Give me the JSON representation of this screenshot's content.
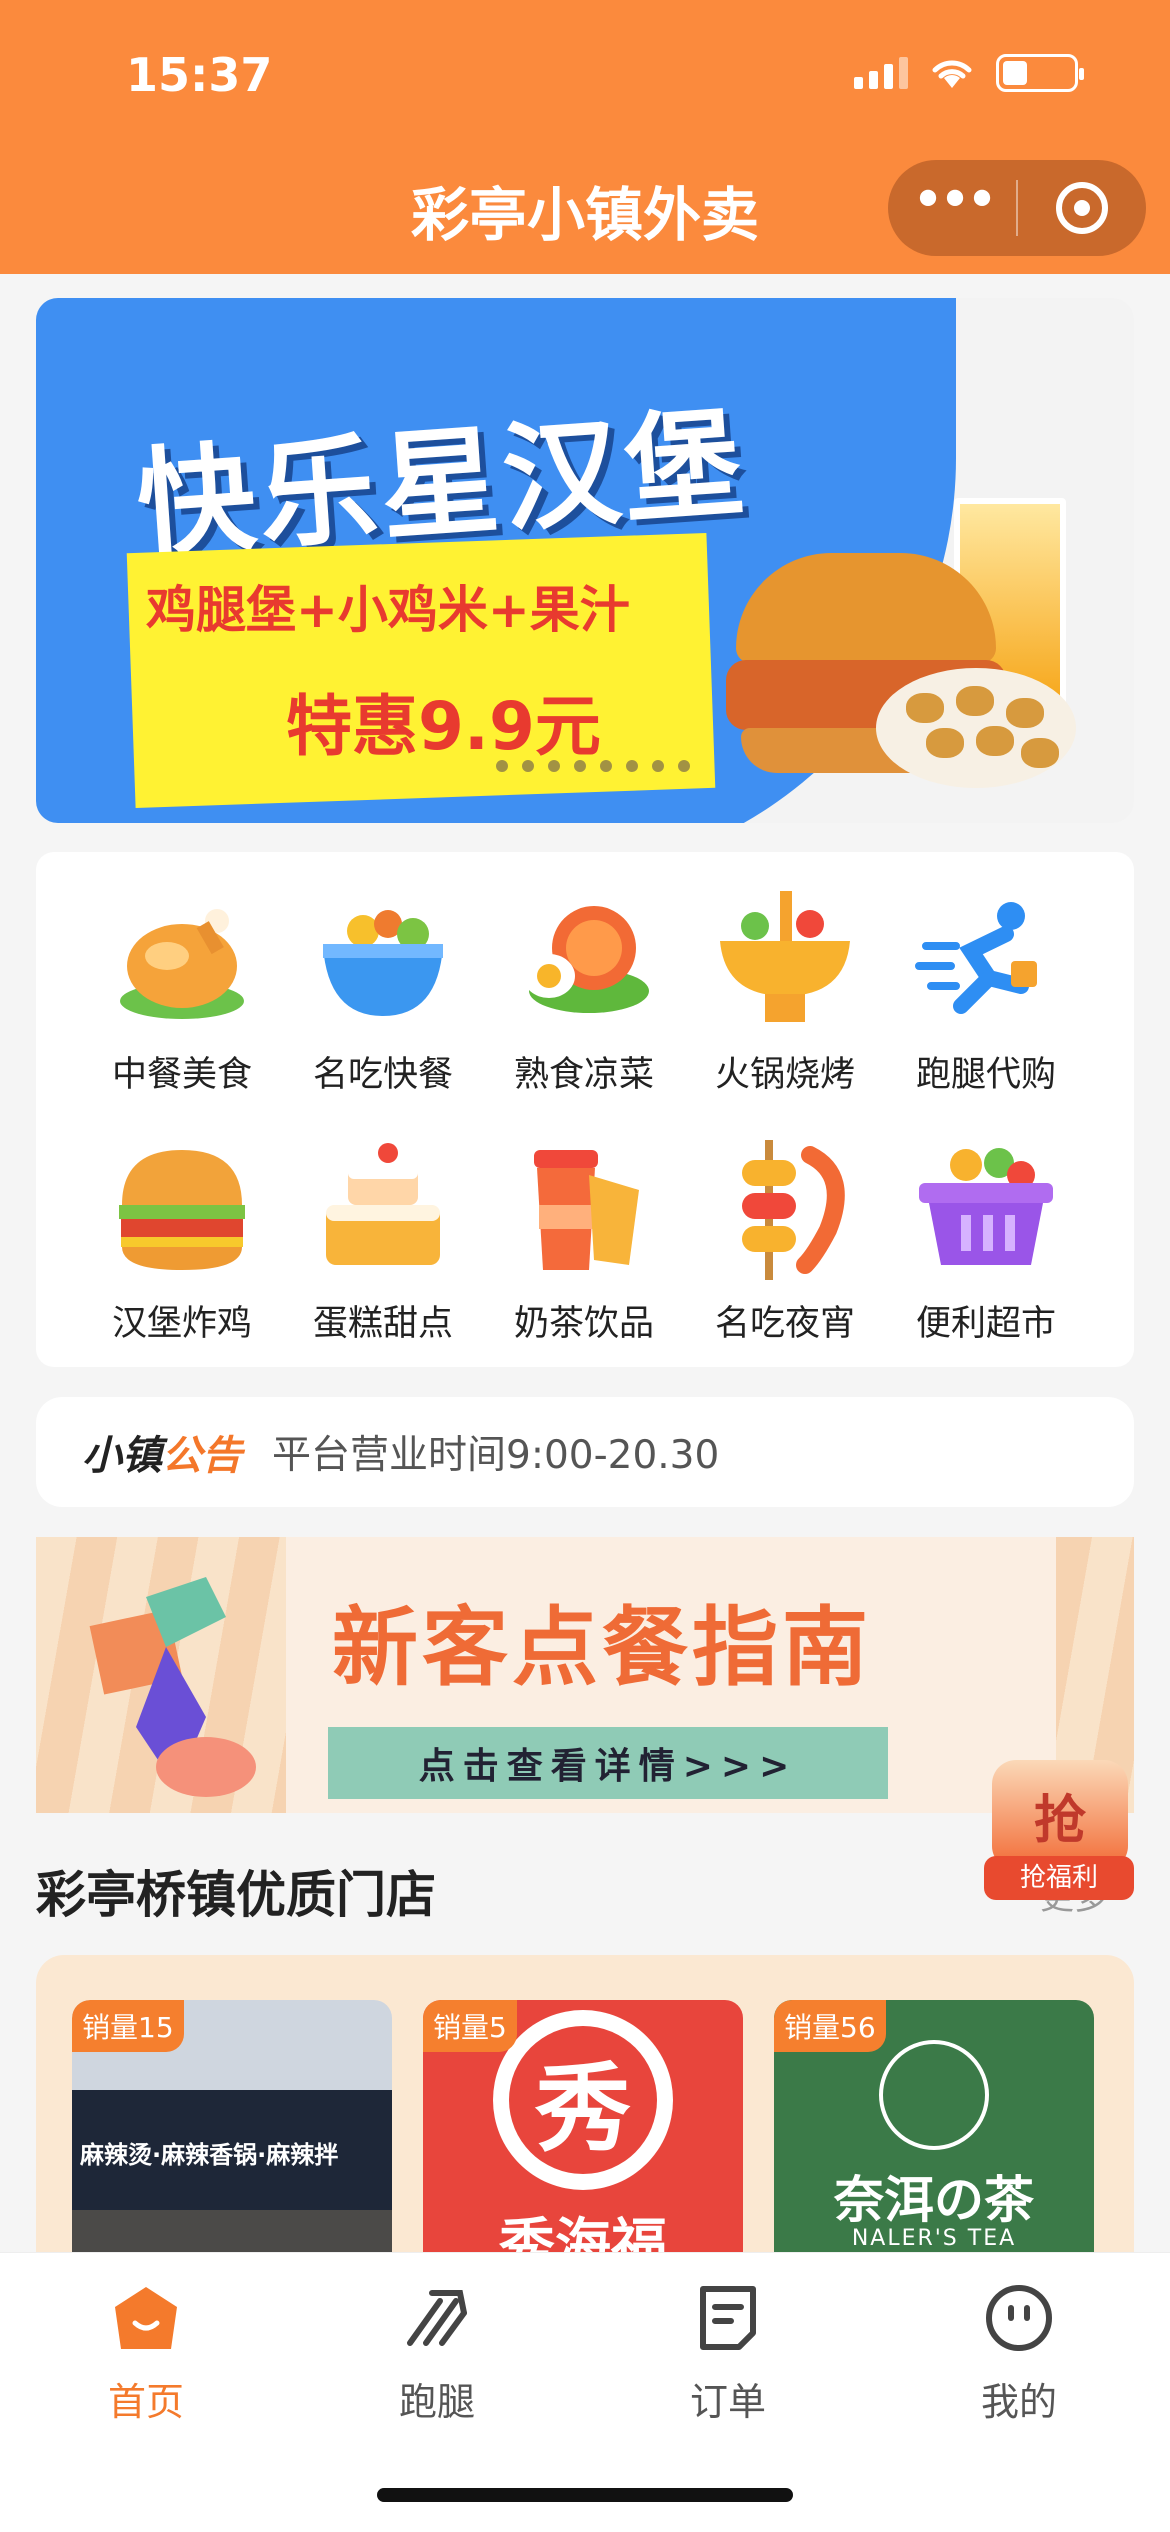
{
  "status_bar": {
    "time": "15:37"
  },
  "header": {
    "title": "彩亭小镇外卖",
    "more_glyph": "•••"
  },
  "banner": {
    "headline": "快乐星汉堡",
    "subtitle": "鸡腿堡+小鸡米+果汁",
    "price": "特惠9.9元"
  },
  "categories": [
    {
      "label": "中餐美食",
      "icon": "roast-chicken-icon"
    },
    {
      "label": "名吃快餐",
      "icon": "bowl-icon"
    },
    {
      "label": "熟食凉菜",
      "icon": "salad-plate-icon"
    },
    {
      "label": "火锅烧烤",
      "icon": "hotpot-icon"
    },
    {
      "label": "跑腿代购",
      "icon": "runner-icon"
    },
    {
      "label": "汉堡炸鸡",
      "icon": "burger-icon"
    },
    {
      "label": "蛋糕甜点",
      "icon": "cake-icon"
    },
    {
      "label": "奶茶饮品",
      "icon": "milk-tea-icon"
    },
    {
      "label": "名吃夜宵",
      "icon": "skewer-icon"
    },
    {
      "label": "便利超市",
      "icon": "basket-icon"
    }
  ],
  "notice": {
    "label_a": "小镇",
    "label_b": "公告",
    "text": "平台营业时间9:00-20.30"
  },
  "guide": {
    "title": "新客点餐指南",
    "button": "点击查看详情>>>"
  },
  "float_badge": {
    "glyph": "抢",
    "label": "抢福利"
  },
  "section": {
    "title": "彩亭桥镇优质门店",
    "more": "更多"
  },
  "shops": [
    {
      "badge": "销量15",
      "sign": "麻辣烫·麻辣香锅·麻辣拌"
    },
    {
      "badge": "销量5",
      "logo": "秀",
      "name": "秀海福"
    },
    {
      "badge": "销量56",
      "name": "奈洱の茶",
      "name_en": "NALER'S TEA"
    }
  ],
  "tabbar": [
    {
      "label": "首页",
      "icon": "home-icon",
      "active": true
    },
    {
      "label": "跑腿",
      "icon": "errand-icon",
      "active": false
    },
    {
      "label": "订单",
      "icon": "order-icon",
      "active": false
    },
    {
      "label": "我的",
      "icon": "profile-icon",
      "active": false
    }
  ],
  "colors": {
    "brand": "#fb8a3d",
    "accent": "#f47a2c",
    "text": "#222222"
  }
}
